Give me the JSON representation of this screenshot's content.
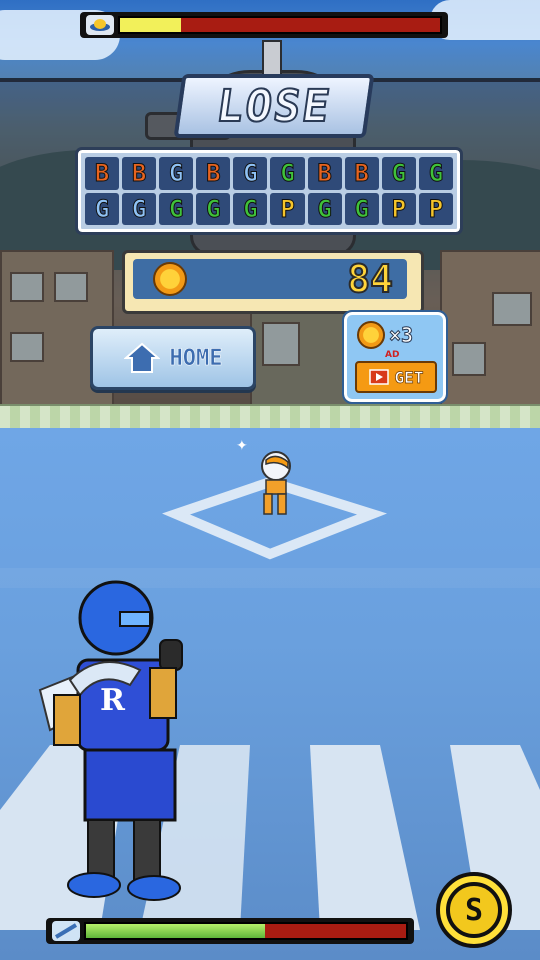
{
  "hud": {
    "top_hp": {
      "icon": "cap-icon",
      "fill_fraction": 0.19
    },
    "bottom_hp": {
      "icon": "bat-icon",
      "fill_fraction": 0.56
    }
  },
  "result": {
    "banner_text": "LOSE"
  },
  "letter_grid": {
    "rows": [
      [
        "B",
        "B",
        "G",
        "B",
        "G",
        "G",
        "B",
        "B",
        "G",
        "G"
      ],
      [
        "G",
        "G",
        "G",
        "G",
        "G",
        "P",
        "G",
        "G",
        "P",
        "P"
      ]
    ],
    "letter_colors": {
      "B": "#e8641f",
      "G": "#3fc23a",
      "P": "#f6c52a",
      "G_blue": "#8fc2f5"
    },
    "tile_variants": [
      [
        "B",
        "B",
        "Gb",
        "B",
        "Gb",
        "G",
        "B",
        "B",
        "G",
        "G"
      ],
      [
        "Gb",
        "Gb",
        "G",
        "G",
        "G",
        "P",
        "G",
        "G",
        "P",
        "P"
      ]
    ]
  },
  "coins": {
    "icon": "coin-icon",
    "value": "84"
  },
  "buttons": {
    "home_label": "HOME",
    "home_icon": "house-icon"
  },
  "ad_offer": {
    "multiplier": "×3",
    "tag": "AD",
    "get_label": "GET",
    "video_icon": "play-video-icon"
  },
  "skill_button": {
    "label": "S"
  },
  "batter": {
    "jersey_letter": "R"
  },
  "colors": {
    "sky": "#2f6fc4",
    "field": "#6fa6e6",
    "hp_fill_top": "#f2f05a",
    "hp_fill_bottom": "#7fd04a",
    "hp_track": "#a81c12"
  }
}
